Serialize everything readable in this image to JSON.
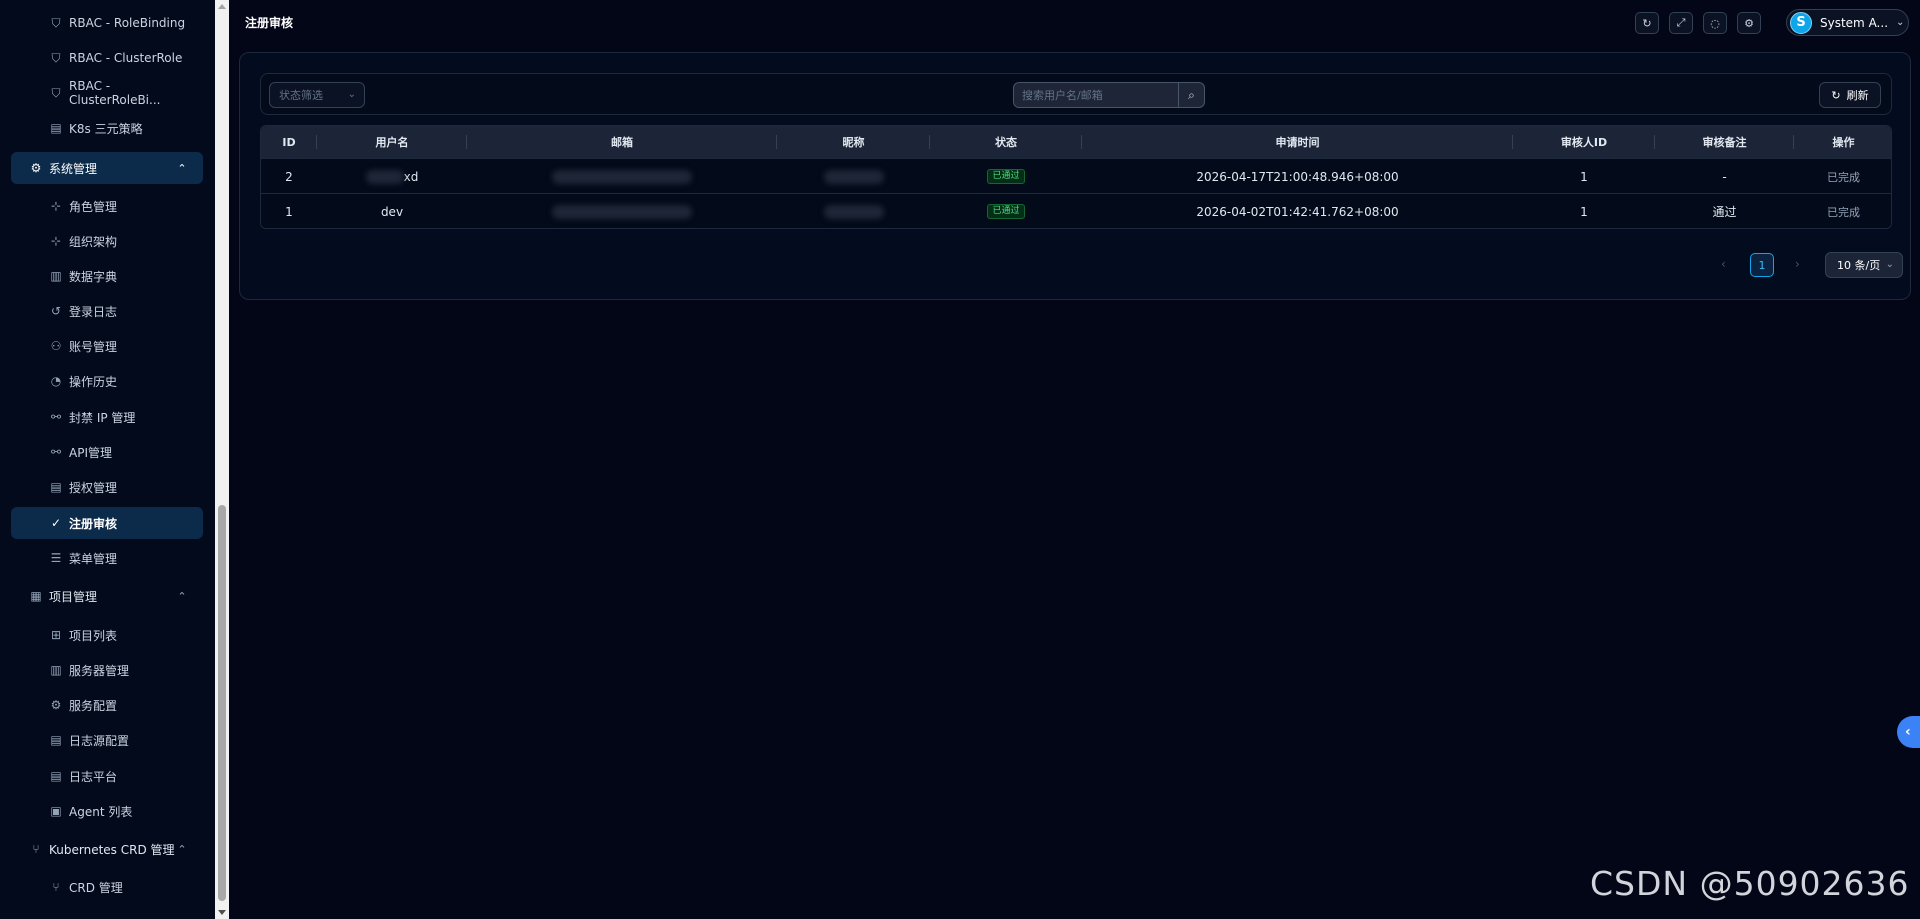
{
  "sidebar": {
    "items": [
      {
        "label": "RBAC - RoleBinding",
        "icon": "shield-icon"
      },
      {
        "label": "RBAC - ClusterRole",
        "icon": "shield-icon"
      },
      {
        "label": "RBAC - ClusterRoleBi...",
        "icon": "shield-icon"
      },
      {
        "label": "K8s 三元策略",
        "icon": "document-icon"
      }
    ],
    "system_group": {
      "label": "系统管理",
      "icon": "gear-icon"
    },
    "system_items": [
      {
        "label": "角色管理",
        "icon": "hierarchy-icon"
      },
      {
        "label": "组织架构",
        "icon": "hierarchy-icon"
      },
      {
        "label": "数据字典",
        "icon": "book-icon"
      },
      {
        "label": "登录日志",
        "icon": "history-icon"
      },
      {
        "label": "账号管理",
        "icon": "users-icon"
      },
      {
        "label": "操作历史",
        "icon": "clock-icon"
      },
      {
        "label": "封禁 IP 管理",
        "icon": "link-icon"
      },
      {
        "label": "API管理",
        "icon": "link-icon"
      },
      {
        "label": "授权管理",
        "icon": "document-icon"
      },
      {
        "label": "注册审核",
        "icon": "check-circle-icon"
      },
      {
        "label": "菜单管理",
        "icon": "menu-icon"
      }
    ],
    "project_group": {
      "label": "项目管理",
      "icon": "layout-icon"
    },
    "project_items": [
      {
        "label": "项目列表",
        "icon": "grid-icon"
      },
      {
        "label": "服务器管理",
        "icon": "book-icon"
      },
      {
        "label": "服务配置",
        "icon": "gear-icon"
      },
      {
        "label": "日志源配置",
        "icon": "document-icon"
      },
      {
        "label": "日志平台",
        "icon": "document-icon"
      },
      {
        "label": "Agent 列表",
        "icon": "monitor-icon"
      }
    ],
    "k8s_group": {
      "label": "Kubernetes CRD 管理",
      "icon": "branch-icon"
    },
    "k8s_items": [
      {
        "label": "CRD 管理",
        "icon": "branch-icon"
      }
    ]
  },
  "header": {
    "title": "注册审核",
    "user_initial": "S",
    "user_name": "System A..."
  },
  "filters": {
    "status_placeholder": "状态筛选",
    "search_placeholder": "搜索用户名/邮箱",
    "refresh_label": "刷新"
  },
  "table": {
    "columns": [
      "ID",
      "用户名",
      "邮箱",
      "昵称",
      "状态",
      "申请时间",
      "审核人ID",
      "审核备注",
      "操作"
    ],
    "rows": [
      {
        "id": "2",
        "username": "xd",
        "status": "已通过",
        "applied_at": "2026-04-17T21:00:48.946+08:00",
        "reviewer_id": "1",
        "remark": "-",
        "action": "已完成"
      },
      {
        "id": "1",
        "username": "dev",
        "status": "已通过",
        "applied_at": "2026-04-02T01:42:41.762+08:00",
        "reviewer_id": "1",
        "remark": "通过",
        "action": "已完成"
      }
    ]
  },
  "pagination": {
    "current_page": "1",
    "page_size": "10 条/页"
  },
  "watermark": "CSDN @50902636"
}
